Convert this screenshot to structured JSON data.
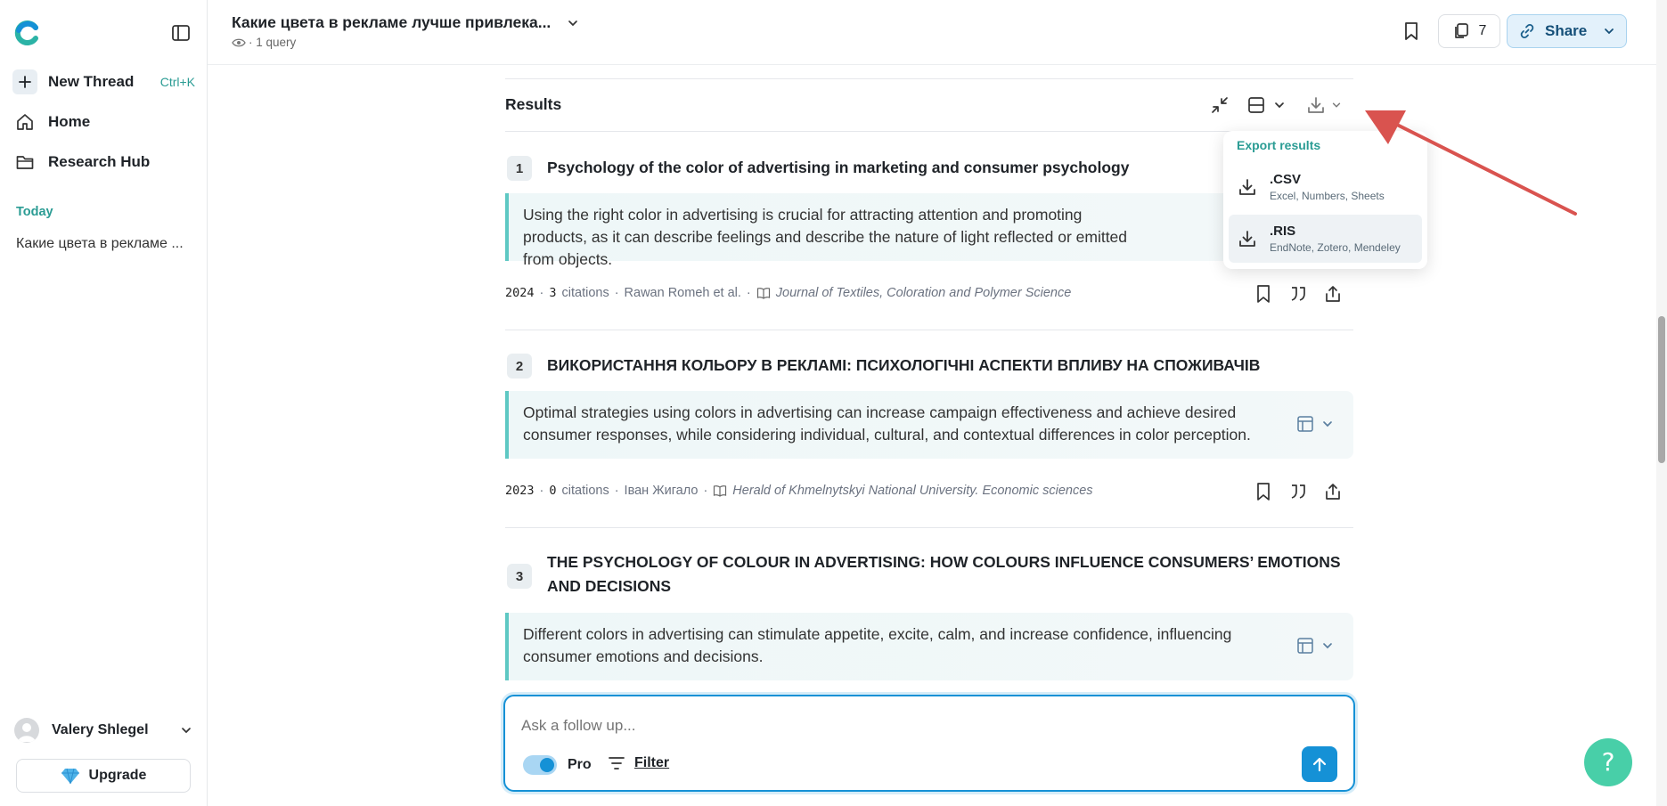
{
  "sidebar": {
    "new_thread": "New Thread",
    "new_thread_shortcut": "Ctrl+K",
    "home": "Home",
    "research_hub": "Research Hub",
    "section_today": "Today",
    "thread_item": "Какие цвета в рекламе ...",
    "user_name": "Valery Shlegel",
    "upgrade": "Upgrade"
  },
  "header": {
    "title": "Какие цвета в рекламе лучше привлека...",
    "subtitle": "· 1 query",
    "sources_count": "7",
    "share": "Share"
  },
  "results": {
    "heading": "Results",
    "items": [
      {
        "num": "1",
        "title": "Psychology of the color of advertising in marketing and consumer psychology",
        "summary": "Using the right color in advertising is crucial for attracting attention and promoting products, as it can describe feelings and describe the nature of light reflected or emitted from objects.",
        "year": "2024",
        "citations_num": "3",
        "citations_label": "citations",
        "authors": "Rawan Romeh  et al.",
        "journal": "Journal of Textiles, Coloration and Polymer Science"
      },
      {
        "num": "2",
        "title": "ВИКОРИСТАННЯ КОЛЬОРУ В РЕКЛАМІ: ПСИХОЛОГІЧНІ АСПЕКТИ ВПЛИВУ НА СПОЖИВАЧІВ",
        "summary": "Optimal strategies using colors in advertising can increase campaign effectiveness and achieve desired consumer responses, while considering individual, cultural, and contextual differences in color perception.",
        "year": "2023",
        "citations_num": "0",
        "citations_label": "citations",
        "authors": "Іван Жигало",
        "journal": "Herald of Khmelnytskyi National University. Economic sciences"
      },
      {
        "num": "3",
        "title": "THE PSYCHOLOGY OF COLOUR IN ADVERTISING: HOW COLOURS INFLUENCE CONSUMERS’ EMOTIONS AND DECISIONS",
        "summary": "Different colors in advertising can stimulate appetite, excite, calm, and increase confidence, influencing consumer emotions and decisions."
      }
    ]
  },
  "export_menu": {
    "heading": "Export results",
    "options": [
      {
        "label": ".CSV",
        "sub": "Excel, Numbers, Sheets"
      },
      {
        "label": ".RIS",
        "sub": "EndNote, Zotero, Mendeley"
      }
    ]
  },
  "followup": {
    "placeholder": "Ask a follow up...",
    "pro_label": "Pro",
    "pro_enabled": true,
    "filter_label": "Filter"
  },
  "colors": {
    "accent": "#1591d6",
    "brand_teal": "#2bb3a6",
    "summary_bar": "#5ec8c3",
    "annotation_arrow": "#d9534f",
    "help_button": "#48cfa8"
  }
}
